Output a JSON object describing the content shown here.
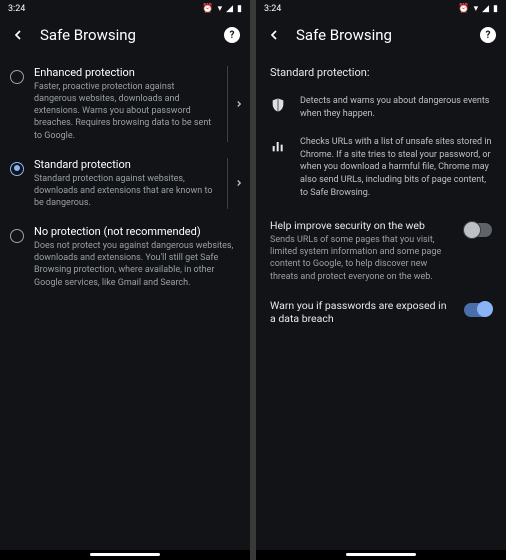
{
  "status": {
    "time": "3:24",
    "icons": "⏰ ▾ ◢ ▌"
  },
  "left": {
    "header": {
      "title": "Safe Browsing"
    },
    "options": [
      {
        "title": "Enhanced protection",
        "desc": "Faster, proactive protection against dangerous websites, downloads and extensions. Warns you about password breaches. Requires browsing data to be sent to Google.",
        "has_chevron": true
      },
      {
        "title": "Standard protection",
        "desc": "Standard protection against websites, downloads and extensions that are known to be dangerous.",
        "has_chevron": true,
        "selected": true
      },
      {
        "title": "No protection (not recommended)",
        "desc": "Does not protect you against dangerous websites, downloads and extensions. You'll still get Safe Browsing protection, where available, in other Google services, like Gmail and Search.",
        "has_chevron": false
      }
    ]
  },
  "right": {
    "header": {
      "title": "Safe Browsing"
    },
    "section_title": "Standard protection:",
    "details": [
      {
        "icon": "shield",
        "text": "Detects and warns you about dangerous events when they happen."
      },
      {
        "icon": "bars",
        "text": "Checks URLs with a list of unsafe sites stored in Chrome. If a site tries to steal your password, or when you download a harmful file, Chrome may also send URLs, including bits of page content, to Safe Browsing."
      }
    ],
    "toggles": [
      {
        "title": "Help improve security on the web",
        "desc": "Sends URLs of some pages that you visit, limited system information and some page content to Google, to help discover new threats and protect everyone on the web.",
        "on": false
      },
      {
        "title": "Warn you if passwords are exposed in a data breach",
        "desc": "",
        "on": true
      }
    ]
  }
}
